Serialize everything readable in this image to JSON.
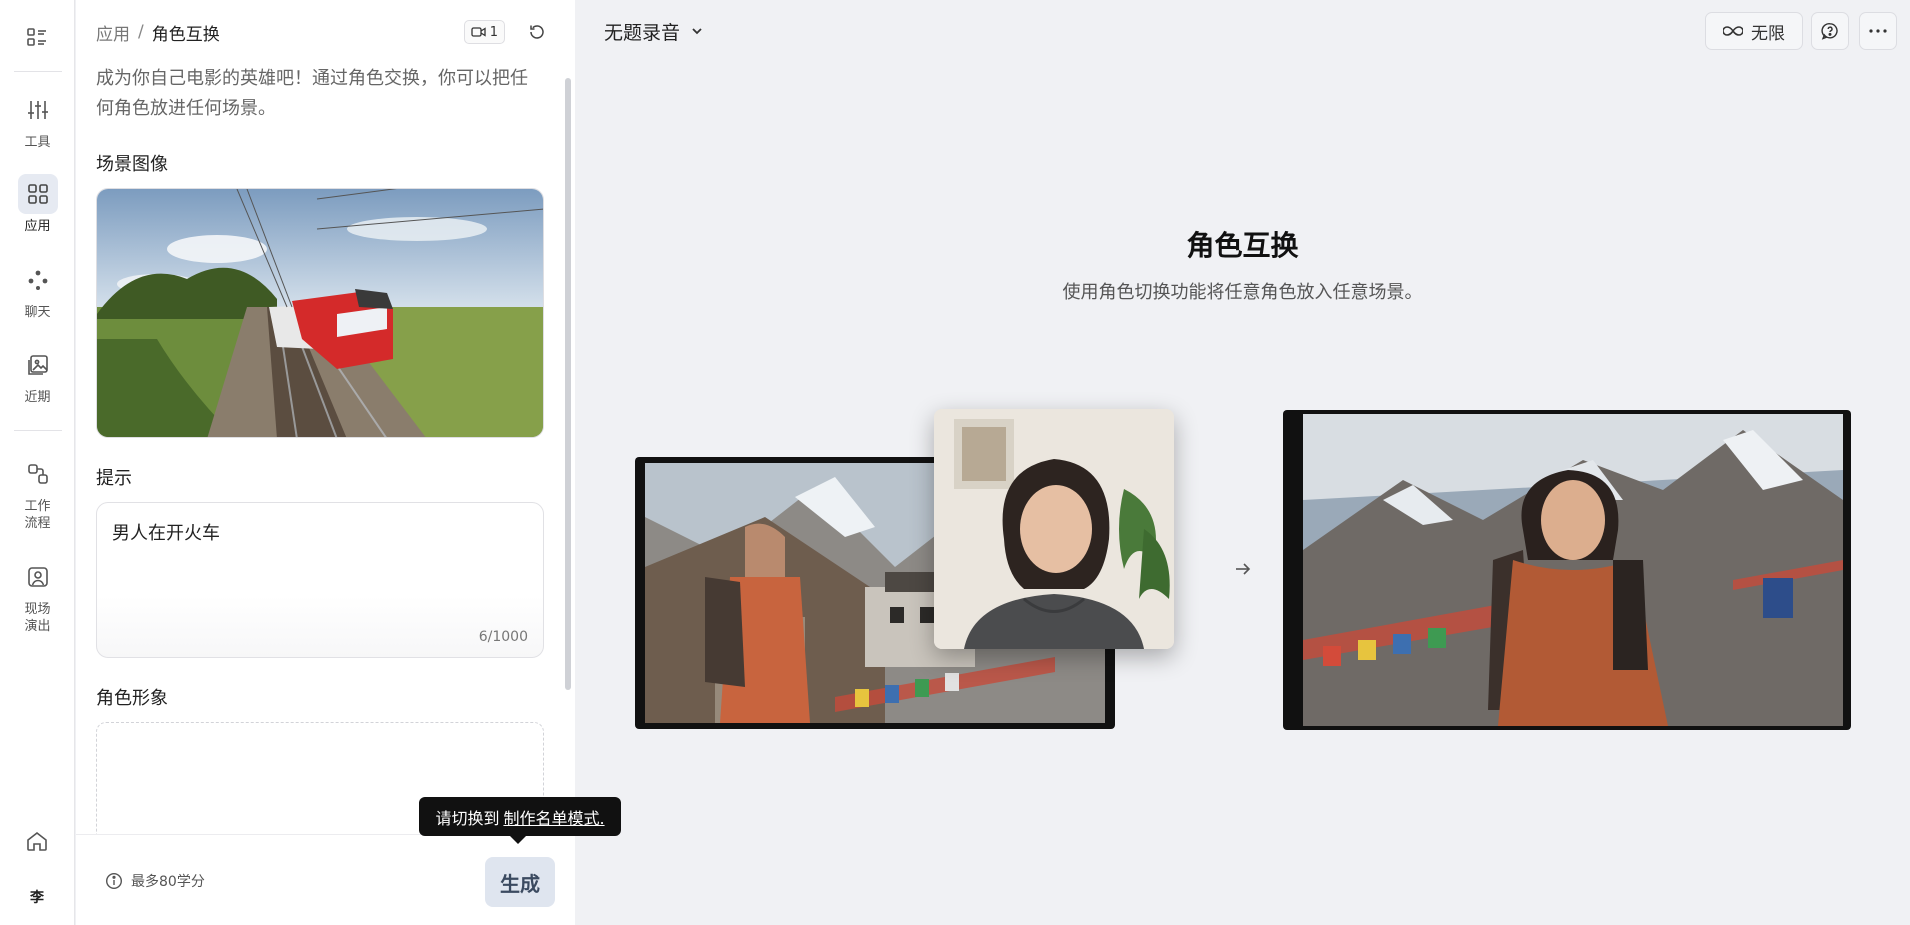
{
  "rail": {
    "items": [
      {
        "label": "工具",
        "icon": "sliders-icon"
      },
      {
        "label": "应用",
        "icon": "grid-icon",
        "active": true
      },
      {
        "label": "聊天",
        "icon": "dots-icon"
      },
      {
        "label": "近期",
        "icon": "gallery-icon"
      },
      {
        "label": "工作\n流程",
        "icon": "workflow-icon"
      },
      {
        "label": "现场\n演出",
        "icon": "portrait-icon"
      }
    ],
    "avatar": "李"
  },
  "panel": {
    "breadcrumb_link": "应用",
    "breadcrumb_sep": "/",
    "breadcrumb_current": "角色互换",
    "video_count": "1",
    "description": "成为你自己电影的英雄吧！通过角色交换，你可以把任何角色放进任何场景。",
    "scene_title": "场景图像",
    "prompt_title": "提示",
    "prompt_value": "男人在开火车",
    "prompt_count": "6/1000",
    "character_title": "角色形象",
    "credit_info": "最多80学分",
    "generate_label": "生成",
    "tooltip_prefix": "请切换到",
    "tooltip_link": "制作名单模式."
  },
  "main": {
    "title": "无题录音",
    "unlimited_label": "无限",
    "hero_title": "角色互换",
    "hero_subtitle": "使用角色切换功能将任意角色放入任意场景。"
  },
  "colors": {
    "accent_active_bg": "#e6eaf2",
    "generate_bg": "#dfe5ef",
    "train_red": "#d42a2a"
  }
}
